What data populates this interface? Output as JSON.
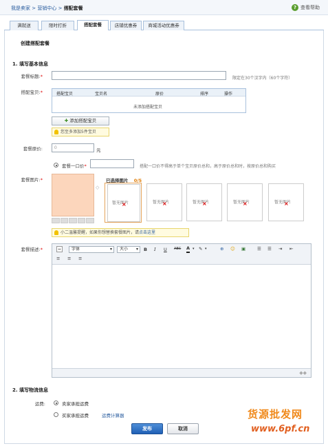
{
  "breadcrumb": {
    "item1": "我是卖家",
    "sep": ">",
    "item2": "营销中心",
    "current": "搭配套餐"
  },
  "help": {
    "label": "查看帮助"
  },
  "tabs": [
    {
      "label": "满就送"
    },
    {
      "label": "限时打折"
    },
    {
      "label": "搭配套餐"
    },
    {
      "label": "店铺优惠券"
    },
    {
      "label": "商城活动优惠券"
    }
  ],
  "page_title": "创建搭配套餐",
  "section1": {
    "title": "1. 填写基本信息"
  },
  "name_field": {
    "label": "套餐标题:",
    "required": "*",
    "value": "",
    "hint": "限定在30个汉字内（60个字符）"
  },
  "products": {
    "label": "搭配宝贝:",
    "required": "*",
    "columns": [
      "搭配宝贝",
      "宝贝名",
      "原价",
      "排序",
      "操作"
    ],
    "empty_text": "未添加搭配宝贝",
    "add_button": "添加搭配宝贝",
    "warn": "您至多添加5件宝贝"
  },
  "original_price": {
    "label": "套餐原价:",
    "value": "0",
    "unit": "元"
  },
  "one_price": {
    "label": "套餐一口价",
    "required": "*",
    "value": "",
    "hint": "搭配一口价不得高于单个宝贝原价总和，高于原价总和时，按原价总和购买"
  },
  "images": {
    "label": "套餐图片:",
    "required": "*",
    "selected_label": "已选择图片",
    "count": "0/5",
    "placeholder": "暂无图片",
    "warn": "小二温馨提醒，如果你想替换套餐图片，请",
    "warn_link": "点击这里"
  },
  "editor": {
    "label": "套餐描述:",
    "required": "*",
    "font_select": "字体",
    "size_select": "大小"
  },
  "section2": {
    "title": "2. 填写物流信息"
  },
  "shipping": {
    "label": "运费:",
    "option1": "卖家承担运费",
    "option2": "买家承担运费",
    "option2_link": "运费计算器"
  },
  "actions": {
    "submit": "发布",
    "cancel": "取消"
  },
  "watermark": {
    "line1": "货源批发网",
    "line2": "www.6pf.cn"
  }
}
